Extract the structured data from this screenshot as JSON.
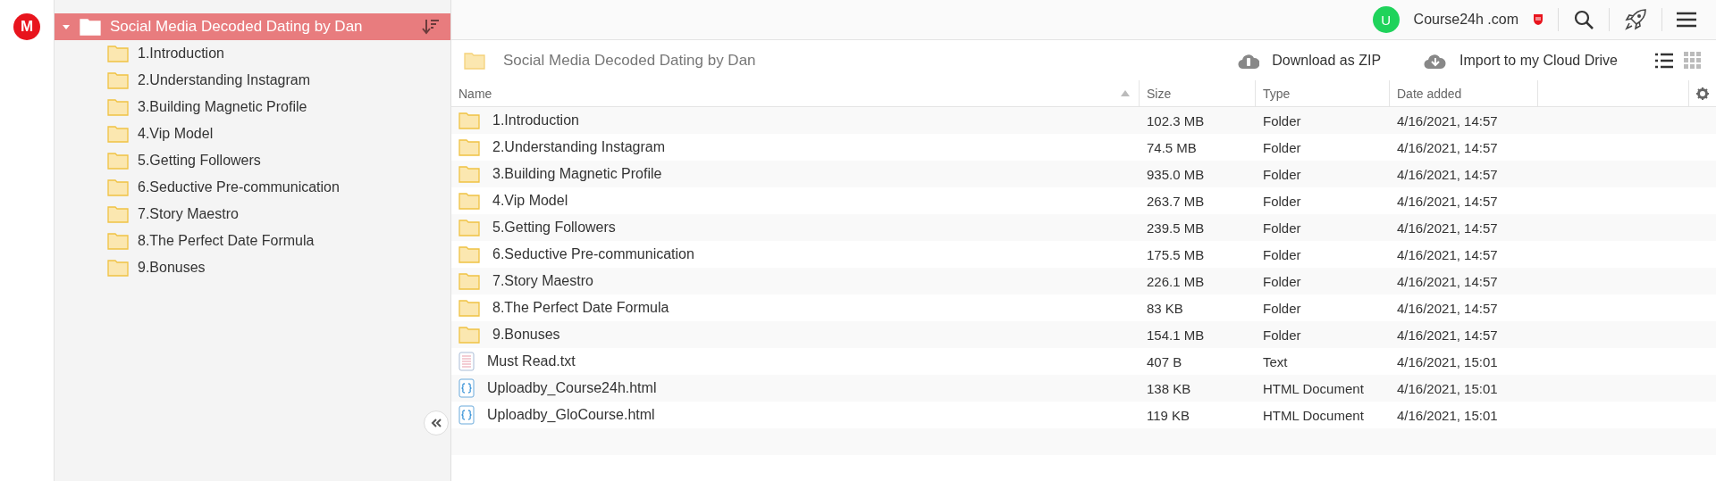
{
  "logo": {
    "letter": "M"
  },
  "tree": {
    "label": "Social Media Decoded Dating by Dan",
    "selected": true,
    "expanded": true,
    "children": [
      {
        "label": "1.Introduction",
        "selected": false
      },
      {
        "label": "2.Understanding Instagram",
        "selected": false
      },
      {
        "label": "3.Building Magnetic Profile",
        "selected": false
      },
      {
        "label": "4.Vip Model",
        "selected": false
      },
      {
        "label": "5.Getting Followers",
        "selected": false
      },
      {
        "label": "6.Seductive Pre-communication",
        "selected": false
      },
      {
        "label": "7.Story Maestro",
        "selected": false
      },
      {
        "label": "8.The Perfect Date Formula",
        "selected": false
      },
      {
        "label": "9.Bonuses",
        "selected": false
      }
    ]
  },
  "account": {
    "avatar_letter": "U",
    "name": "Course24h .com"
  },
  "folder_title": "Social Media Decoded Dating by Dan",
  "actions": [
    "Download as ZIP",
    "Import to my Cloud Drive"
  ],
  "view_mode": {
    "list_selected": true
  },
  "table": {
    "columns": [
      "Name",
      "Size",
      "Type",
      "Date added"
    ],
    "rows": [
      {
        "kind": "folder",
        "name": "1.Introduction",
        "size": "102.3 MB",
        "type": "Folder",
        "date": "4/16/2021, 14:57"
      },
      {
        "kind": "folder",
        "name": "2.Understanding Instagram",
        "size": "74.5 MB",
        "type": "Folder",
        "date": "4/16/2021, 14:57"
      },
      {
        "kind": "folder",
        "name": "3.Building Magnetic Profile",
        "size": "935.0 MB",
        "type": "Folder",
        "date": "4/16/2021, 14:57"
      },
      {
        "kind": "folder",
        "name": "4.Vip Model",
        "size": "263.7 MB",
        "type": "Folder",
        "date": "4/16/2021, 14:57"
      },
      {
        "kind": "folder",
        "name": "5.Getting Followers",
        "size": "239.5 MB",
        "type": "Folder",
        "date": "4/16/2021, 14:57"
      },
      {
        "kind": "folder",
        "name": "6.Seductive Pre-communication",
        "size": "175.5 MB",
        "type": "Folder",
        "date": "4/16/2021, 14:57"
      },
      {
        "kind": "folder",
        "name": "7.Story Maestro",
        "size": "226.1 MB",
        "type": "Folder",
        "date": "4/16/2021, 14:57"
      },
      {
        "kind": "folder",
        "name": "8.The Perfect Date Formula",
        "size": "83 KB",
        "type": "Folder",
        "date": "4/16/2021, 14:57"
      },
      {
        "kind": "folder",
        "name": "9.Bonuses",
        "size": "154.1 MB",
        "type": "Folder",
        "date": "4/16/2021, 14:57"
      },
      {
        "kind": "text",
        "name": "Must Read.txt",
        "size": "407 B",
        "type": "Text",
        "date": "4/16/2021, 15:01"
      },
      {
        "kind": "html",
        "name": "Uploadby_Course24h.html",
        "size": "138 KB",
        "type": "HTML Document",
        "date": "4/16/2021, 15:01"
      },
      {
        "kind": "html",
        "name": "Uploadby_GloCourse.html",
        "size": "119 KB",
        "type": "HTML Document",
        "date": "4/16/2021, 15:01"
      }
    ]
  }
}
